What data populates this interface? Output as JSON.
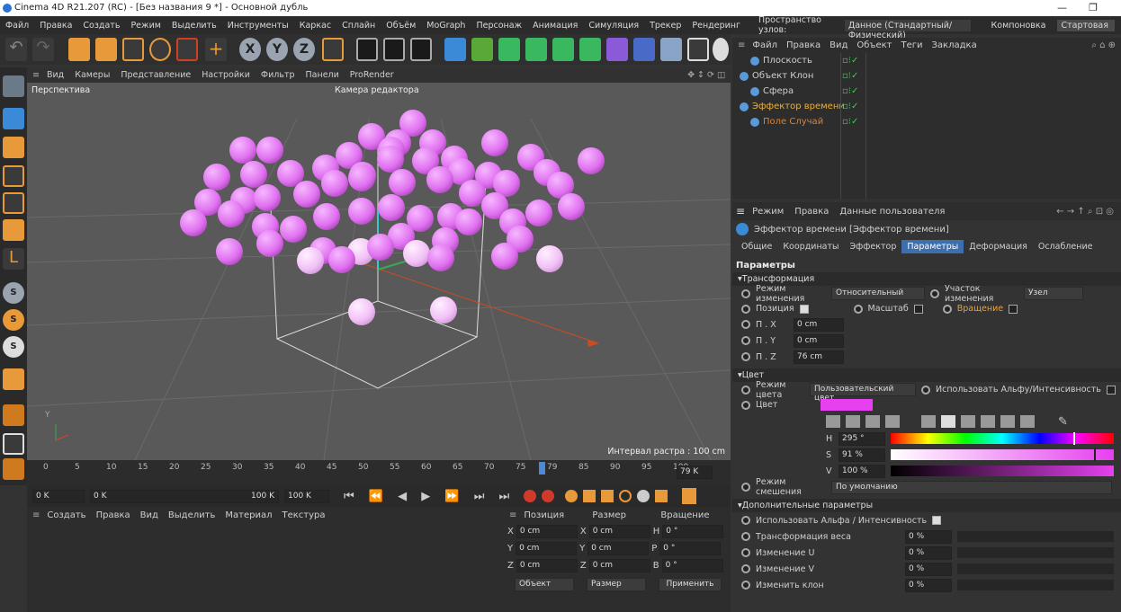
{
  "title": "Cinema 4D R21.207 (RC) - [Без названия 9 *] - Основной дубль",
  "menu": [
    "Файл",
    "Правка",
    "Создать",
    "Режим",
    "Выделить",
    "Инструменты",
    "Каркас",
    "Сплайн",
    "Объём",
    "MoGraph",
    "Персонаж",
    "Анимация",
    "Симуляция",
    "Трекер",
    "Рендеринг"
  ],
  "node_space": {
    "label": "Пространство узлов:",
    "value": "Данное (Стандартный/Физический)"
  },
  "layout": {
    "label": "Компоновка",
    "value": "Стартовая"
  },
  "viewport": {
    "menu": [
      "Вид",
      "Камеры",
      "Представление",
      "Настройки",
      "Фильтр",
      "Панели",
      "ProRender"
    ],
    "name": "Перспектива",
    "camera": "Камера редактора",
    "grid_info": "Интервал растра : 100 cm",
    "sphere_color": "#e070f0"
  },
  "timeline": {
    "ticks": [
      "0",
      "5",
      "10",
      "15",
      "20",
      "25",
      "30",
      "35",
      "40",
      "45",
      "50",
      "55",
      "60",
      "65",
      "70",
      "75",
      "79",
      "85",
      "90",
      "95",
      "100"
    ],
    "current_frame": 79,
    "current_label": "79 K"
  },
  "transport": {
    "start": "0 K",
    "min": "0 K",
    "max": "100 K",
    "end": "100 K"
  },
  "material": {
    "menu": [
      "Создать",
      "Правка",
      "Вид",
      "Выделить",
      "Материал",
      "Текстура"
    ]
  },
  "coords": {
    "headers": [
      "Позиция",
      "Размер",
      "Вращение"
    ],
    "rows": [
      {
        "a": "X",
        "p": "0 cm",
        "b": "X",
        "s": "0 cm",
        "c": "H",
        "r": "0 °"
      },
      {
        "a": "Y",
        "p": "0 cm",
        "b": "Y",
        "s": "0 cm",
        "c": "P",
        "r": "0 °"
      },
      {
        "a": "Z",
        "p": "0 cm",
        "b": "Z",
        "s": "0 cm",
        "c": "B",
        "r": "0 °"
      }
    ],
    "object_mode": "Объект",
    "size_mode": "Размер",
    "apply": "Применить"
  },
  "objects": {
    "menu": [
      "Файл",
      "Правка",
      "Вид",
      "Объект",
      "Теги",
      "Закладка"
    ],
    "items": [
      {
        "name": "Плоскость",
        "indent": 1,
        "color": "#cfcfcf"
      },
      {
        "name": "Объект Клон",
        "indent": 0,
        "color": "#cfcfcf"
      },
      {
        "name": "Сфера",
        "indent": 1,
        "color": "#cfcfcf"
      },
      {
        "name": "Эффектор времени",
        "indent": 0,
        "color": "#f0b030"
      },
      {
        "name": "Поле Случай",
        "indent": 1,
        "color": "#e08030"
      }
    ]
  },
  "attributes": {
    "menu": [
      "Режим",
      "Правка",
      "Данные пользователя"
    ],
    "header": "Эффектор времени [Эффектор времени]",
    "tabs": [
      "Общие",
      "Координаты",
      "Эффектор",
      "Параметры",
      "Деформация",
      "Ослабление"
    ],
    "active_tab": "Параметры",
    "params_title": "Параметры",
    "transform_title": "Трансформация",
    "mode_label": "Режим изменения",
    "mode_value": "Относительный",
    "range_label": "Участок изменения",
    "range_value": "Узел",
    "pos_label": "Позиция",
    "scale_label": "Масштаб",
    "rot_label": "Вращение",
    "px_label": "П . X",
    "px": "0 cm",
    "py_label": "П . Y",
    "py": "0 cm",
    "pz_label": "П . Z",
    "pz": "76 cm",
    "color_title": "Цвет",
    "color_mode_label": "Режим цвета",
    "color_mode_value": "Пользовательский цвет",
    "use_alpha_label": "Использовать Альфу/Интенсивность",
    "color_label": "Цвет",
    "swatch": "#e640f0",
    "picker_tabs": [
      "RGB",
      "HSV",
      "K",
      "≡",
      "#",
      "⊞"
    ],
    "h_label": "H",
    "h_value": "295 °",
    "s_label": "S",
    "s_value": "91 %",
    "v_label": "V",
    "v_value": "100 %",
    "blend_label": "Режим смешения",
    "blend_value": "По умолчанию",
    "extra_title": "Дополнительные параметры",
    "extra_alpha_label": "Использовать Альфа / Интенсивность",
    "weight_label": "Трансформация веса",
    "weight": "0 %",
    "u_label": "Изменение U",
    "u": "0 %",
    "v2_label": "Изменение V",
    "v2": "0 %",
    "clone_label": "Изменить клон",
    "clone": "0 %"
  }
}
